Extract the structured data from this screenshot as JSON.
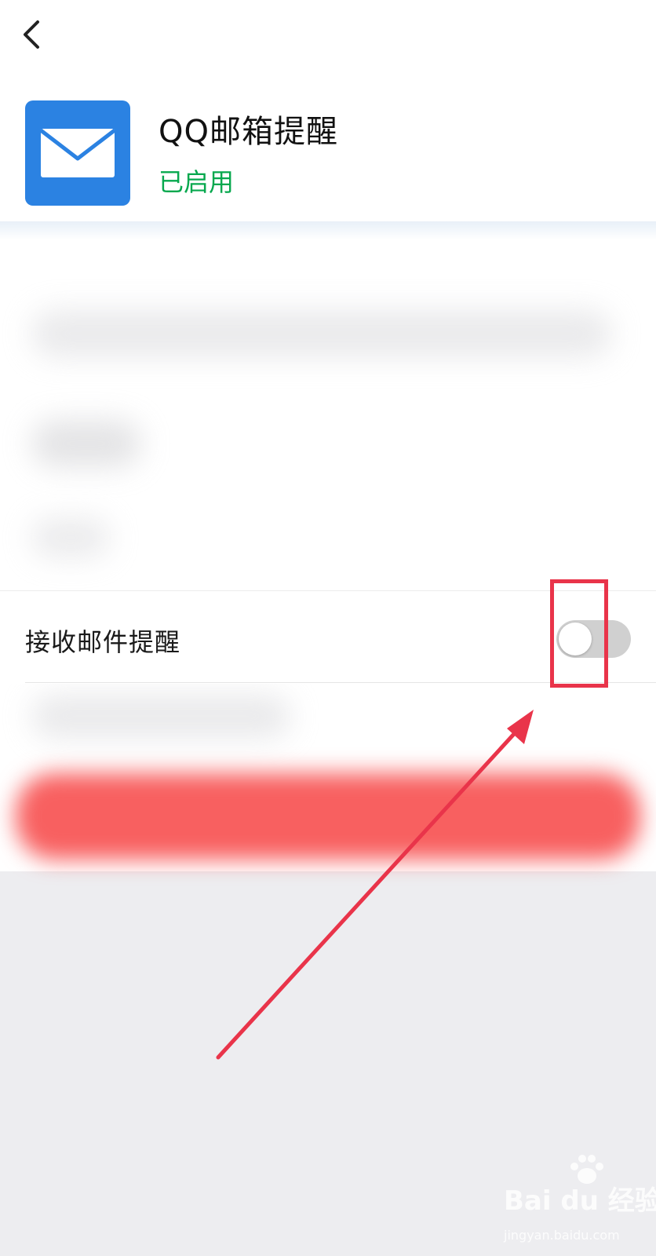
{
  "app": {
    "title": "QQ邮箱提醒",
    "status": "已启用",
    "status_color": "#07a84e",
    "icon": "mail-envelope-icon",
    "icon_bg": "#2b82e2"
  },
  "nav": {
    "back_icon": "chevron-left-icon"
  },
  "settings": {
    "receive_mail_alert": {
      "label": "接收邮件提醒",
      "enabled": false
    }
  },
  "annotation": {
    "highlight_color": "#e9344a",
    "note": ""
  },
  "watermark": {
    "main": "Bai du 经验",
    "sub": "jingyan.baidu.com"
  }
}
